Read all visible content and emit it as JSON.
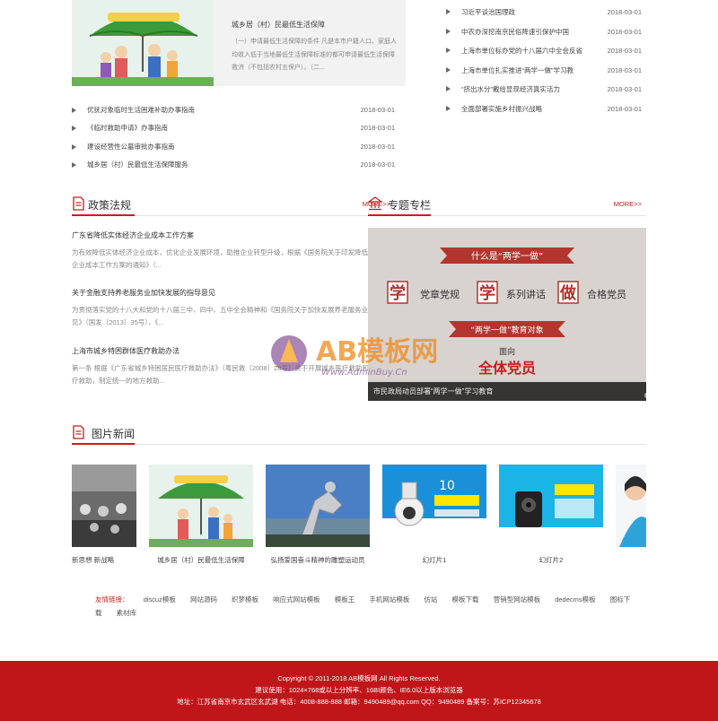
{
  "feature": {
    "title": "城乡居（村）民最低生活保障",
    "desc": "（一）申请最低生活保障的条件 凡是本市户籍人口、家庭人均收入低于当地最低生活保障标准的都可申请最低生活保障救济（不包括农村五保户）。（二..."
  },
  "news_left": [
    {
      "text": "优抚对象临时生活困难补助办事指南",
      "date": "2018-03-01"
    },
    {
      "text": "《临时救助申请》办事指南",
      "date": "2018-03-01"
    },
    {
      "text": "建设经营性公墓审批办事指南",
      "date": "2018-03-01"
    },
    {
      "text": "城乡居（村）民最低生活保障服务",
      "date": "2018-03-01"
    }
  ],
  "news_right": [
    {
      "text": "习近平谈治国理政",
      "date": "2018-03-01"
    },
    {
      "text": "中农办深挖南京民俗降速引保护中国",
      "date": "2018-03-01"
    },
    {
      "text": "上海市单位标办党的十八届六中全会反省",
      "date": "2018-03-01"
    },
    {
      "text": "上海市单位扎实推进“两学一做”学习教",
      "date": "2018-03-01"
    },
    {
      "text": "“挤出水分”戴给显现经济真实活力",
      "date": "2018-03-01"
    },
    {
      "text": "全面部署实施乡村振兴战略",
      "date": "2018-03-01"
    }
  ],
  "policy": {
    "title": "政策法规",
    "more": "MORE>>",
    "items": [
      {
        "title": "广东省降低实体经济企业成本工作方案",
        "desc": "为有效降低实体经济企业成本，优化企业发展环境，助推企业转型升级，根据《国务院关于印发降低实体经济企业成本工作方案的通知》（..."
      },
      {
        "title": "关于金融支持养老服务业加快发展的指导意见",
        "desc": "为贯彻落实党的十八大和党的十八届三中、四中、五中全会精神和《国务院关于加快发展养老服务业的若干意见》（国发〔2013〕35号），《..."
      },
      {
        "title": "上海市城乡特困群体医疗救助办法",
        "desc": "第一条 根据《广东省城乡特困居民医疗救助办法》（粤民救〔2008〕28号）关于开展城乡医疗救助和优抚医疗救助，制定统一的地方救助..."
      }
    ]
  },
  "topic": {
    "title": "专题专栏",
    "more": "MORE>>",
    "banner_top": "什么是“两学一做”",
    "banner_main": [
      "学",
      "党章党规",
      "学",
      "系列讲话",
      "做",
      "合格党员"
    ],
    "banner_mid": "“两学一做”教育对象",
    "banner_face": "面向",
    "banner_party": "全体党员",
    "caption": "市民政局动员部署“两学一做”学习教育",
    "dots": 4,
    "active_dot": 3
  },
  "pictures": {
    "title": "图片新闻",
    "items": [
      {
        "caption": "新思想 新战略"
      },
      {
        "caption": "城乡居（村）民最低生活保障"
      },
      {
        "caption": "弘扬爱国奋斗精神的雕塑运动员"
      },
      {
        "caption": "幻灯片1"
      },
      {
        "caption": "幻灯片2"
      },
      {
        "caption": ""
      }
    ]
  },
  "links": {
    "label": "友情链接：",
    "items": [
      "discuz模板",
      "网站源码",
      "织梦模板",
      "响应式网站模板",
      "模板王",
      "手机网站模板",
      "仿站",
      "模板下载",
      "营销型网站模板",
      "dedecms模板",
      "图标下载",
      "素材库"
    ]
  },
  "footer": {
    "line1": "Copyright © 2011-2018 AB模板网 All Rights Reserved.",
    "line2": "建议使用：1024×768或以上分辨率、16BI颜色、IE6.0以上版本浏览器",
    "line3": "地址：江苏省南京市玄武区玄武湖 电话：4008-888-888 邮箱：9490489@qq.com QQ：9490489 备案号：苏ICP12345678"
  },
  "watermark": {
    "brand": "AB模板网",
    "url": "Www.AdminBuy.Cn"
  },
  "colors": {
    "accent": "#c81e1e",
    "footer": "#c0161a"
  }
}
